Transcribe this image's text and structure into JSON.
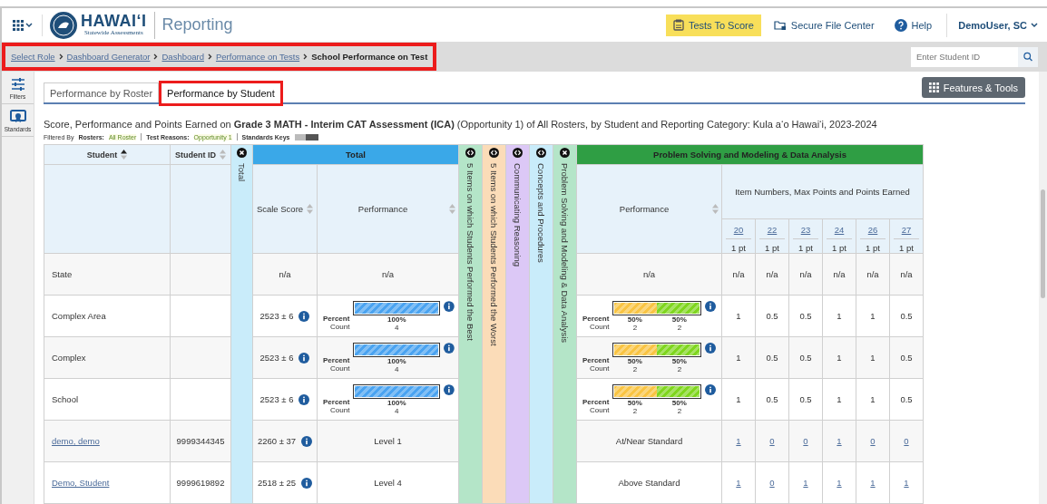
{
  "app_bar": {
    "logo_title": "HAWAIʻI",
    "logo_subtitle": "Statewide Assessments",
    "app_name": "Reporting",
    "actions": [
      {
        "label": "Tests To Score",
        "kind": "score"
      },
      {
        "label": "Secure File Center",
        "kind": "file"
      },
      {
        "label": "Help",
        "kind": "help"
      }
    ],
    "user": "DemoUser, SC"
  },
  "breadcrumb": {
    "highlighted": true,
    "items": [
      {
        "label": "Select Role",
        "current": false
      },
      {
        "label": "Dashboard Generator",
        "current": false
      },
      {
        "label": "Dashboard",
        "current": false
      },
      {
        "label": "Performance on Tests",
        "current": false
      },
      {
        "label": "School Performance on Test",
        "current": true
      }
    ]
  },
  "student_search": {
    "placeholder": "Enter Student ID"
  },
  "sidebar": {
    "items": [
      {
        "label": "Filters",
        "kind": "filters"
      },
      {
        "label": "Standards",
        "kind": "standards"
      }
    ]
  },
  "tabs": [
    {
      "label": "Performance by Roster",
      "selected": false,
      "highlighted": false
    },
    {
      "label": "Performance by Student",
      "selected": true,
      "highlighted": true
    }
  ],
  "features_button": "Features & Tools",
  "report_title": "Score, Performance and Points Earned on **Grade 3 MATH - Interim CAT Assessment (ICA)** (Opportunity 1) of All Rosters, by Student and Reporting Category: Kula a‘o Hawai‘i, 2023-2024",
  "filters": {
    "label": "Filtered By",
    "items": [
      {
        "name": "Rosters:",
        "value": "All Roster"
      },
      {
        "name": "Test Reasons:",
        "value": "Opportunity 1"
      }
    ],
    "standards_keys": "Standards Keys"
  },
  "table": {
    "columns": [
      {
        "label": "Student",
        "sorted": true
      },
      {
        "label": "Student ID",
        "sorted": false
      }
    ],
    "total_collapsed": {
      "label": "Total",
      "color": "#c9ecfa",
      "kind": "close"
    },
    "total_group": {
      "label": "Total",
      "color": "#3aa8e8",
      "columns": [
        "Scale Score",
        "Performance"
      ]
    },
    "category_columns": [
      {
        "label": "5 Items on which Students Performed the Best",
        "color": "#b4e5c8",
        "kind": "expand"
      },
      {
        "label": "5 Items on which Students Performed the Worst",
        "color": "#fbdcb8",
        "kind": "expand"
      },
      {
        "label": "Communicating Reasoning",
        "color": "#dcc8f6",
        "kind": "expand"
      },
      {
        "label": "Concepts and Procedures",
        "color": "#c9ecfa",
        "kind": "expand"
      },
      {
        "label": "Problem Solving and Modeling & Data Analysis",
        "color": "#b4e5c8",
        "kind": "close"
      }
    ],
    "category_group": {
      "label": "Problem Solving and Modeling & Data Analysis",
      "color": "#2f9e44",
      "performance_label": "Performance",
      "items_label": "Item Numbers, Max Points and Points Earned",
      "items": [
        {
          "number": "20",
          "points": "1 pt"
        },
        {
          "number": "22",
          "points": "1 pt"
        },
        {
          "number": "23",
          "points": "1 pt"
        },
        {
          "number": "24",
          "points": "1 pt"
        },
        {
          "number": "26",
          "points": "1 pt"
        },
        {
          "number": "27",
          "points": "1 pt"
        }
      ]
    },
    "rows": [
      {
        "student": "State",
        "link": false,
        "score": "n/a",
        "info": false,
        "performance": {
          "kind": "text",
          "text": "n/a"
        },
        "category_performance": {
          "kind": "text",
          "text": "n/a"
        },
        "points": [
          "n/a",
          "n/a",
          "n/a",
          "n/a",
          "n/a",
          "n/a"
        ]
      },
      {
        "student": "Complex Area",
        "link": false,
        "score": "2523 ± 6",
        "info": true,
        "performance": {
          "kind": "bar",
          "percent_label": "Percent",
          "count_label": "Count",
          "segments": [
            {
              "color": "#4aa3f0",
              "level": 1,
              "percent": "100%",
              "count": "4"
            }
          ]
        },
        "category_performance": {
          "kind": "bar",
          "percent_label": "Percent",
          "count_label": "Count",
          "segments": [
            {
              "color": "#f9c443",
              "level": 0.5,
              "percent": "50%",
              "count": "2"
            },
            {
              "color": "#7fd61e",
              "level": 0.5,
              "percent": "50%",
              "count": "2"
            }
          ]
        },
        "points": [
          "1",
          "0.5",
          "0.5",
          "1",
          "1",
          "0.5"
        ]
      },
      {
        "student": "Complex",
        "link": false,
        "score": "2523 ± 6",
        "info": true,
        "performance": {
          "kind": "bar",
          "percent_label": "Percent",
          "count_label": "Count",
          "segments": [
            {
              "color": "#4aa3f0",
              "level": 1,
              "percent": "100%",
              "count": "4"
            }
          ]
        },
        "category_performance": {
          "kind": "bar",
          "percent_label": "Percent",
          "count_label": "Count",
          "segments": [
            {
              "color": "#f9c443",
              "level": 0.5,
              "percent": "50%",
              "count": "2"
            },
            {
              "color": "#7fd61e",
              "level": 0.5,
              "percent": "50%",
              "count": "2"
            }
          ]
        },
        "points": [
          "1",
          "0.5",
          "0.5",
          "1",
          "1",
          "0.5"
        ]
      },
      {
        "student": "School",
        "link": false,
        "score": "2523 ± 6",
        "info": true,
        "performance": {
          "kind": "bar",
          "percent_label": "Percent",
          "count_label": "Count",
          "segments": [
            {
              "color": "#4aa3f0",
              "level": 1,
              "percent": "100%",
              "count": "4"
            }
          ]
        },
        "category_performance": {
          "kind": "bar",
          "percent_label": "Percent",
          "count_label": "Count",
          "segments": [
            {
              "color": "#f9c443",
              "level": 0.5,
              "percent": "50%",
              "count": "2"
            },
            {
              "color": "#7fd61e",
              "level": 0.5,
              "percent": "50%",
              "count": "2"
            }
          ]
        },
        "points": [
          "1",
          "0.5",
          "0.5",
          "1",
          "1",
          "0.5"
        ]
      },
      {
        "student": "demo, demo",
        "link": true,
        "student_id": "9999344345",
        "score": "2260 ± 37",
        "info": true,
        "performance": {
          "kind": "text",
          "text": "Level 1"
        },
        "category_performance": {
          "kind": "text",
          "text": "At/Near Standard"
        },
        "points": [
          "1",
          "0",
          "0",
          "1",
          "0",
          "0"
        ]
      },
      {
        "student": "Demo, Student",
        "link": true,
        "student_id": "9999619892",
        "score": "2518 ± 25",
        "info": true,
        "performance": {
          "kind": "text",
          "text": "Level 4"
        },
        "category_performance": {
          "kind": "text",
          "text": "Above Standard"
        },
        "points": [
          "1",
          "0",
          "1",
          "1",
          "1",
          "1"
        ]
      }
    ]
  }
}
